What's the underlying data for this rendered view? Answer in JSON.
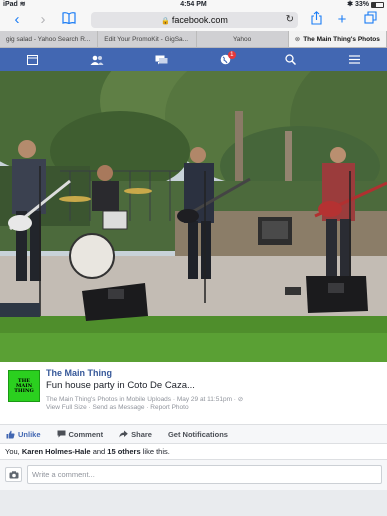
{
  "status_bar": {
    "device": "iPad",
    "time": "4:54 PM",
    "battery": "33%"
  },
  "browser": {
    "url": "facebook.com",
    "icons": [
      "back-icon",
      "forward-icon",
      "bookmarks-icon",
      "lock-icon",
      "reload-icon",
      "share-icon",
      "new-tab-icon",
      "tabs-icon"
    ]
  },
  "tabs": [
    {
      "label": "gig salad - Yahoo Search R..."
    },
    {
      "label": "Edit Your PromoKit - GigSa..."
    },
    {
      "label": "Yahoo"
    },
    {
      "label": "The Main Thing's Photos"
    }
  ],
  "fb_nav": {
    "badge_count": "1",
    "icons": [
      "news-feed-icon",
      "friend-requests-icon",
      "messages-icon",
      "notifications-globe-icon",
      "search-icon",
      "menu-icon"
    ],
    "color": "#4267b2"
  },
  "post": {
    "page_thumb_text": "THE MAIN THING",
    "author": "The Main Thing",
    "text": "Fun house party in Coto De Caza...",
    "meta": "The Main Thing's Photos in Mobile Uploads · May 29 at 11:51pm · ⊘",
    "links": "View Full Size · Send as Message · Report Photo"
  },
  "actions": {
    "unlike": "Unlike",
    "comment": "Comment",
    "share": "Share",
    "notifications": "Get Notifications"
  },
  "likes": {
    "prefix": "You, ",
    "person": "Karen Holmes-Hale",
    "middle": " and ",
    "others": "15 others",
    "suffix": " like this."
  },
  "comment": {
    "placeholder": "Write a comment..."
  }
}
